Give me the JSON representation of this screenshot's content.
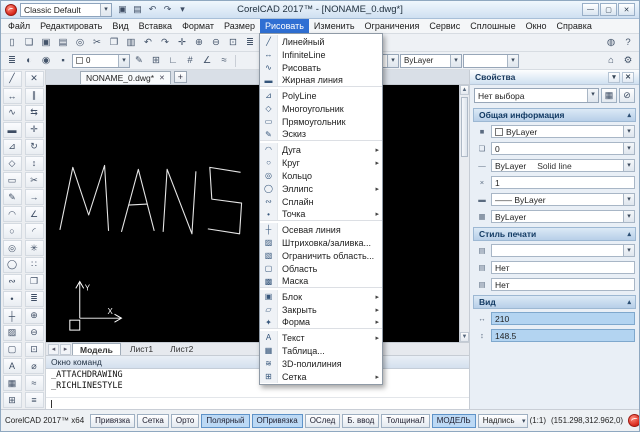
{
  "titlebar": {
    "workspace": "Classic Default",
    "title": "CorelCAD 2017™ - [NONAME_0.dwg*]",
    "quick_icons": [
      {
        "name": "save-icon",
        "glyph": "▣"
      },
      {
        "name": "print-icon",
        "glyph": "▤"
      },
      {
        "name": "undo-icon",
        "glyph": "↶"
      },
      {
        "name": "redo-icon",
        "glyph": "↷"
      },
      {
        "name": "toolbar-options-icon",
        "glyph": "▾"
      }
    ],
    "window_buttons": {
      "minimize": "—",
      "maximize": "▢",
      "close": "✕"
    }
  },
  "menubar": {
    "items": [
      {
        "label": "Файл"
      },
      {
        "label": "Редактировать"
      },
      {
        "label": "Вид"
      },
      {
        "label": "Вставка"
      },
      {
        "label": "Формат"
      },
      {
        "label": "Размер"
      },
      {
        "label": "Рисовать",
        "active": true
      },
      {
        "label": "Изменить"
      },
      {
        "label": "Ограничения"
      },
      {
        "label": "Сервис"
      },
      {
        "label": "Сплошные"
      },
      {
        "label": "Окно"
      },
      {
        "label": "Справка"
      }
    ]
  },
  "draw_menu": {
    "items": [
      {
        "icon": "line-icon",
        "glyph": "╱",
        "label": "Линейный"
      },
      {
        "icon": "infinite-line-icon",
        "glyph": "↔",
        "label": "InfiniteLine"
      },
      {
        "icon": "freehand-icon",
        "glyph": "∿",
        "label": "Рисовать"
      },
      {
        "icon": "heavy-line-icon",
        "glyph": "▬",
        "label": "Жирная линия",
        "separator_after": true
      },
      {
        "icon": "polyline-icon",
        "glyph": "⊿",
        "label": "PolyLine"
      },
      {
        "icon": "polygon-icon",
        "glyph": "◇",
        "label": "Многоугольник"
      },
      {
        "icon": "rectangle-icon",
        "glyph": "▭",
        "label": "Прямоугольник"
      },
      {
        "icon": "sketch-icon",
        "glyph": "✎",
        "label": "Эскиз",
        "separator_after": true
      },
      {
        "icon": "arc-icon",
        "glyph": "◠",
        "label": "Дуга",
        "submenu": true
      },
      {
        "icon": "circle-icon",
        "glyph": "○",
        "label": "Круг",
        "submenu": true
      },
      {
        "icon": "ring-icon",
        "glyph": "◎",
        "label": "Кольцо"
      },
      {
        "icon": "ellipse-icon",
        "glyph": "◯",
        "label": "Эллипс",
        "submenu": true
      },
      {
        "icon": "spline-icon",
        "glyph": "∾",
        "label": "Сплайн"
      },
      {
        "icon": "point-icon",
        "glyph": "•",
        "label": "Точка",
        "submenu": true,
        "separator_after": true
      },
      {
        "icon": "centerline-icon",
        "glyph": "┼",
        "label": "Осевая линия"
      },
      {
        "icon": "hatch-fill-icon",
        "glyph": "▨",
        "label": "Штриховка/заливка..."
      },
      {
        "icon": "bounded-area-icon",
        "glyph": "▧",
        "label": "Ограничить область..."
      },
      {
        "icon": "region-icon",
        "glyph": "▢",
        "label": "Область"
      },
      {
        "icon": "mask-icon",
        "glyph": "▩",
        "label": "Маска",
        "separator_after": true
      },
      {
        "icon": "block-icon",
        "glyph": "▣",
        "label": "Блок",
        "submenu": true
      },
      {
        "icon": "close-shape-icon",
        "glyph": "▱",
        "label": "Закрыть",
        "submenu": true
      },
      {
        "icon": "shape-icon",
        "glyph": "✦",
        "label": "Форма",
        "submenu": true,
        "separator_after": true
      },
      {
        "icon": "text-icon",
        "glyph": "A",
        "label": "Текст",
        "submenu": true
      },
      {
        "icon": "table-icon",
        "glyph": "▦",
        "label": "Таблица..."
      },
      {
        "icon": "polyline-3d-icon",
        "glyph": "≋",
        "label": "3D-полилиния"
      },
      {
        "icon": "mesh-icon",
        "glyph": "⊞",
        "label": "Сетка",
        "submenu": true
      }
    ]
  },
  "toolbar1": {
    "icons": [
      {
        "name": "new-file-icon",
        "glyph": "▯"
      },
      {
        "name": "open-file-icon",
        "glyph": "❏"
      },
      {
        "name": "save-file-icon",
        "glyph": "▣"
      },
      {
        "name": "print-file-icon",
        "glyph": "▤"
      },
      {
        "name": "print-preview-icon",
        "glyph": "◎"
      },
      {
        "name": "cut-icon",
        "glyph": "✂"
      },
      {
        "name": "copy-icon",
        "glyph": "❐"
      },
      {
        "name": "paste-icon",
        "glyph": "▥"
      },
      {
        "name": "undo-icon",
        "glyph": "↶"
      },
      {
        "name": "redo-icon",
        "glyph": "↷"
      },
      {
        "name": "pan-icon",
        "glyph": "✛"
      },
      {
        "name": "zoom-in-icon",
        "glyph": "⊕"
      },
      {
        "name": "zoom-out-icon",
        "glyph": "⊖"
      },
      {
        "name": "zoom-fit-icon",
        "glyph": "⊡"
      },
      {
        "name": "layers-manager-icon",
        "glyph": "≣"
      },
      {
        "name": "properties-panel-icon",
        "glyph": "▧"
      }
    ],
    "view_combo": {
      "name": "view-select",
      "value": ""
    },
    "right_icons": [
      {
        "name": "render-style-icon",
        "glyph": "◍"
      },
      {
        "name": "help-icon",
        "glyph": "?"
      }
    ]
  },
  "toolbar2": {
    "icons_left": [
      {
        "name": "layer-manager-icon",
        "glyph": "≣"
      },
      {
        "name": "layer-visibility-icon",
        "glyph": "◐"
      },
      {
        "name": "layer-freeze-icon",
        "glyph": "◉"
      },
      {
        "name": "layer-color-icon",
        "glyph": "▪"
      }
    ],
    "layer_combo": {
      "name": "layer-select",
      "value": "0"
    },
    "icons_mid": [
      {
        "name": "entity-layer-icon",
        "glyph": "✎"
      },
      {
        "name": "grid-toggle-icon",
        "glyph": "⊞"
      },
      {
        "name": "ortho-toggle-icon",
        "glyph": "∟"
      },
      {
        "name": "snap-toggle-icon",
        "glyph": "#"
      },
      {
        "name": "polar-toggle-icon",
        "glyph": "∠"
      },
      {
        "name": "track-toggle-icon",
        "glyph": "≈"
      }
    ],
    "combos": [
      {
        "name": "lineweight-select",
        "value": "—— ByLayer"
      },
      {
        "name": "linestyle-select",
        "value": "ByLayer"
      },
      {
        "name": "linecolor-select",
        "value": ""
      }
    ],
    "right_icons": [
      {
        "name": "match-properties-icon",
        "glyph": "⌂"
      },
      {
        "name": "options-icon",
        "glyph": "⚙"
      }
    ]
  },
  "palette": {
    "col_a": [
      {
        "name": "line-tool-icon",
        "glyph": "╱"
      },
      {
        "name": "infinite-line-tool-icon",
        "glyph": "↔"
      },
      {
        "name": "freehand-tool-icon",
        "glyph": "∿"
      },
      {
        "name": "heavy-line-tool-icon",
        "glyph": "▬"
      },
      {
        "name": "polyline-tool-icon",
        "glyph": "⊿"
      },
      {
        "name": "polygon-tool-icon",
        "glyph": "◇"
      },
      {
        "name": "rectangle-tool-icon",
        "glyph": "▭"
      },
      {
        "name": "sketch-tool-icon",
        "glyph": "✎"
      },
      {
        "name": "arc-tool-icon",
        "glyph": "◠"
      },
      {
        "name": "circle-tool-icon",
        "glyph": "○"
      },
      {
        "name": "ring-tool-icon",
        "glyph": "◎"
      },
      {
        "name": "ellipse-tool-icon",
        "glyph": "◯"
      },
      {
        "name": "spline-tool-icon",
        "glyph": "∾"
      },
      {
        "name": "point-tool-icon",
        "glyph": "•"
      },
      {
        "name": "centerline-tool-icon",
        "glyph": "┼"
      },
      {
        "name": "hatch-tool-icon",
        "glyph": "▨"
      },
      {
        "name": "region-tool-icon",
        "glyph": "▢"
      },
      {
        "name": "text-tool-icon",
        "glyph": "A"
      },
      {
        "name": "table-tool-icon",
        "glyph": "▦"
      },
      {
        "name": "mesh-tool-icon",
        "glyph": "⊞"
      }
    ],
    "col_b": [
      {
        "name": "erase-tool-icon",
        "glyph": "✕"
      },
      {
        "name": "offset-tool-icon",
        "glyph": "∥"
      },
      {
        "name": "mirror-tool-icon",
        "glyph": "⇆"
      },
      {
        "name": "move-tool-icon",
        "glyph": "✛"
      },
      {
        "name": "rotate-tool-icon",
        "glyph": "↻"
      },
      {
        "name": "scale-tool-icon",
        "glyph": "↕"
      },
      {
        "name": "trim-tool-icon",
        "glyph": "✂"
      },
      {
        "name": "extend-tool-icon",
        "glyph": "→"
      },
      {
        "name": "chamfer-tool-icon",
        "glyph": "∠"
      },
      {
        "name": "fillet-tool-icon",
        "glyph": "◜"
      },
      {
        "name": "explode-tool-icon",
        "glyph": "✳"
      },
      {
        "name": "pattern-tool-icon",
        "glyph": "∷"
      },
      {
        "name": "copy-tool-icon",
        "glyph": "❐"
      },
      {
        "name": "properties-tool-icon",
        "glyph": "≣"
      },
      {
        "name": "zoom-in-tool-icon",
        "glyph": "⊕"
      },
      {
        "name": "zoom-out-tool-icon",
        "glyph": "⊖"
      },
      {
        "name": "zoom-fit-tool-icon",
        "glyph": "⊡"
      },
      {
        "name": "diameter-tool-icon",
        "glyph": "⌀"
      },
      {
        "name": "smooth-tool-icon",
        "glyph": "≈"
      },
      {
        "name": "list-tool-icon",
        "glyph": "≡"
      }
    ]
  },
  "doc_tabs": {
    "tabs": [
      {
        "label": "NONAME_0.dwg*"
      }
    ],
    "close_glyph": "✕",
    "add_label": "+"
  },
  "canvas": {
    "drawn_text": "MANS",
    "axis_x": "X",
    "axis_y": "Y"
  },
  "model_tabs": {
    "nav": [
      {
        "name": "model-tabs-prev-icon",
        "glyph": "◂"
      },
      {
        "name": "model-tabs-next-icon",
        "glyph": "▸"
      }
    ],
    "items": [
      {
        "label": "Модель",
        "active": true
      },
      {
        "label": "Лист1"
      },
      {
        "label": "Лист2"
      }
    ]
  },
  "command": {
    "title": "Окно команд",
    "lines": [
      "_ATTACHDRAWING",
      "_RICHLINESTYLE"
    ],
    "input": ""
  },
  "properties": {
    "title": "Свойства",
    "title_buttons": [
      {
        "name": "panel-menu-icon",
        "glyph": "▾"
      },
      {
        "name": "close-icon",
        "glyph": "✕"
      }
    ],
    "selection": "Нет выбора",
    "selection_buttons": [
      {
        "name": "select-elements-button",
        "glyph": "▦"
      },
      {
        "name": "clear-selection-button",
        "glyph": "⊘"
      }
    ],
    "sections": {
      "general": "Общая информация",
      "print": "Стиль печати",
      "view": "Вид"
    },
    "general_rows": [
      {
        "icon": "color-property-icon",
        "glyph": "■",
        "name": "color-select",
        "value": "ByLayer",
        "caret": true,
        "swatch": true
      },
      {
        "icon": "layer-property-icon",
        "glyph": "❏",
        "name": "layer-select",
        "value": "0",
        "caret": true
      },
      {
        "icon": "linestyle-property-icon",
        "glyph": "—",
        "name": "linestyle-select",
        "value": "ByLayer",
        "value2": "Solid line",
        "caret": true
      },
      {
        "icon": "linestyle-scale-property-icon",
        "glyph": "×",
        "name": "linestyle-scale-field",
        "value": "1"
      },
      {
        "icon": "lineweight-property-icon",
        "glyph": "▬",
        "name": "lineweight-select",
        "value": "—— ByLayer",
        "caret": true
      },
      {
        "icon": "transparency-property-icon",
        "glyph": "▦",
        "name": "transparency-select",
        "value": "ByLayer",
        "caret": true
      }
    ],
    "print_rows": [
      {
        "icon": "print-style-property-icon",
        "glyph": "▤",
        "name": "print-style-select",
        "value": "",
        "caret": true
      },
      {
        "icon": "print-table-property-icon",
        "glyph": "▤",
        "name": "print-style-table-field",
        "value": "Нет"
      },
      {
        "icon": "print-view-property-icon",
        "glyph": "▤",
        "name": "print-style-view-field",
        "value": "Нет"
      }
    ],
    "view_rows": [
      {
        "icon": "view-width-property-icon",
        "glyph": "↔",
        "name": "view-width-field",
        "value": "210",
        "highlight": true
      },
      {
        "icon": "view-height-property-icon",
        "glyph": "↕",
        "name": "view-height-field",
        "value": "148.5",
        "highlight": true
      }
    ]
  },
  "statusbar": {
    "app_label": "CorelCAD 2017™ x64",
    "toggles": [
      {
        "label": "Привязка"
      },
      {
        "label": "Сетка"
      },
      {
        "label": "Орто"
      },
      {
        "label": "Полярный",
        "active": true
      },
      {
        "label": "ОПривязка",
        "active": true
      },
      {
        "label": "ОСлед"
      },
      {
        "label": "Б. ввод"
      },
      {
        "label": "ТолщинаЛ"
      },
      {
        "label": "МОДЕЛЬ",
        "active": true
      }
    ],
    "annotation_label": "Надпись",
    "scale": "(1:1)",
    "coordinates": "(151.298,312.962,0)"
  }
}
